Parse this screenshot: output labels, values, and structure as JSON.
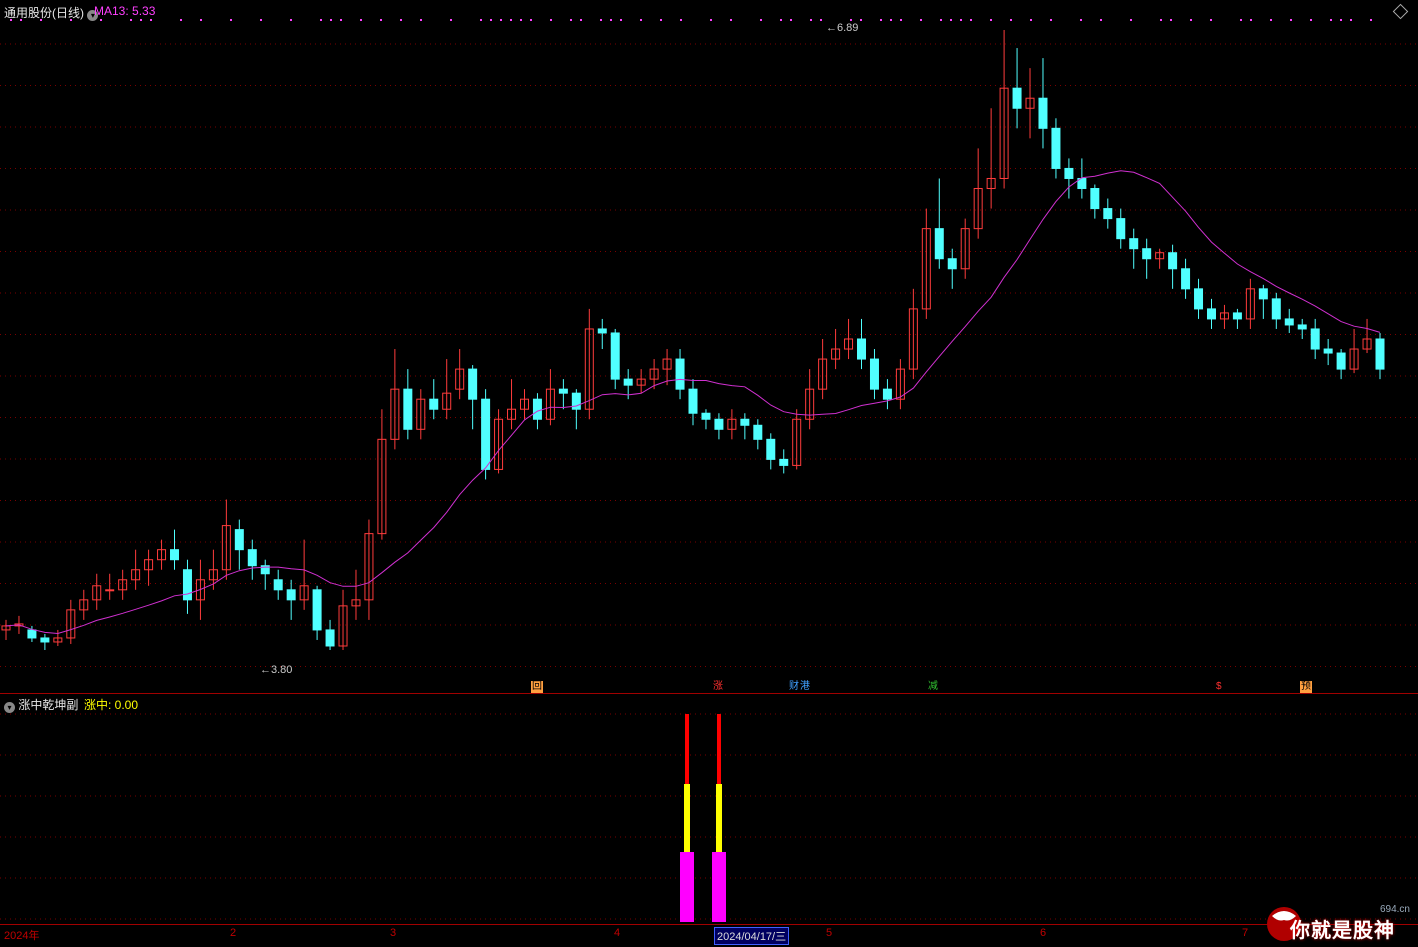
{
  "header": {
    "title": "通用股份(日线)",
    "ma_label": "MA13: 5.33"
  },
  "price_annotations": {
    "high": "6.89",
    "low": "3.80"
  },
  "signal_marks": [
    {
      "label": "回",
      "color": "#ffa040"
    },
    {
      "label": "涨",
      "color": "#ff3030"
    },
    {
      "label": "财",
      "color": "#40a0ff"
    },
    {
      "label": "港",
      "color": "#40a0ff"
    },
    {
      "label": "减",
      "color": "#30c030"
    },
    {
      "label": "$",
      "color": "#ff3030"
    },
    {
      "label": "预",
      "color": "#ffa040"
    }
  ],
  "sub_panel": {
    "title": "涨中乾坤副",
    "value": "涨中: 0.00"
  },
  "x_axis": {
    "labels": [
      "2024年",
      "2",
      "3",
      "4",
      "5",
      "6",
      "7"
    ],
    "cursor_date": "2024/04/17/三"
  },
  "logo": {
    "text": "你就是股神",
    "site": "694.cn"
  },
  "colors": {
    "up": "#ff3c3c",
    "down": "#50ffff",
    "ma": "#d030d0",
    "grid": "#7a0000"
  },
  "chart_data": {
    "type": "candlestick",
    "price_range": [
      3.8,
      6.89
    ],
    "series": [
      {
        "name": "MA13",
        "values": [
          3.9,
          3.93,
          3.96,
          4.0,
          4.03,
          4.06,
          4.08,
          4.1,
          4.12,
          4.14,
          4.16,
          4.17,
          4.19,
          4.22,
          4.3,
          4.4,
          4.5,
          4.58,
          4.65,
          4.7,
          4.74,
          4.78,
          4.81,
          4.83,
          4.85,
          4.86,
          4.87,
          4.87,
          4.88,
          4.88,
          4.9,
          4.92,
          4.95,
          4.98,
          5.03,
          5.1,
          5.2,
          5.35,
          5.55,
          5.75,
          5.95,
          6.1,
          6.2,
          6.25,
          6.26,
          6.25,
          6.22,
          6.2,
          6.18,
          6.12,
          6.05,
          5.98,
          5.92,
          5.86,
          5.82,
          5.76,
          5.72,
          5.66,
          5.62,
          5.58,
          5.55,
          5.52,
          5.48
        ]
      }
    ]
  }
}
